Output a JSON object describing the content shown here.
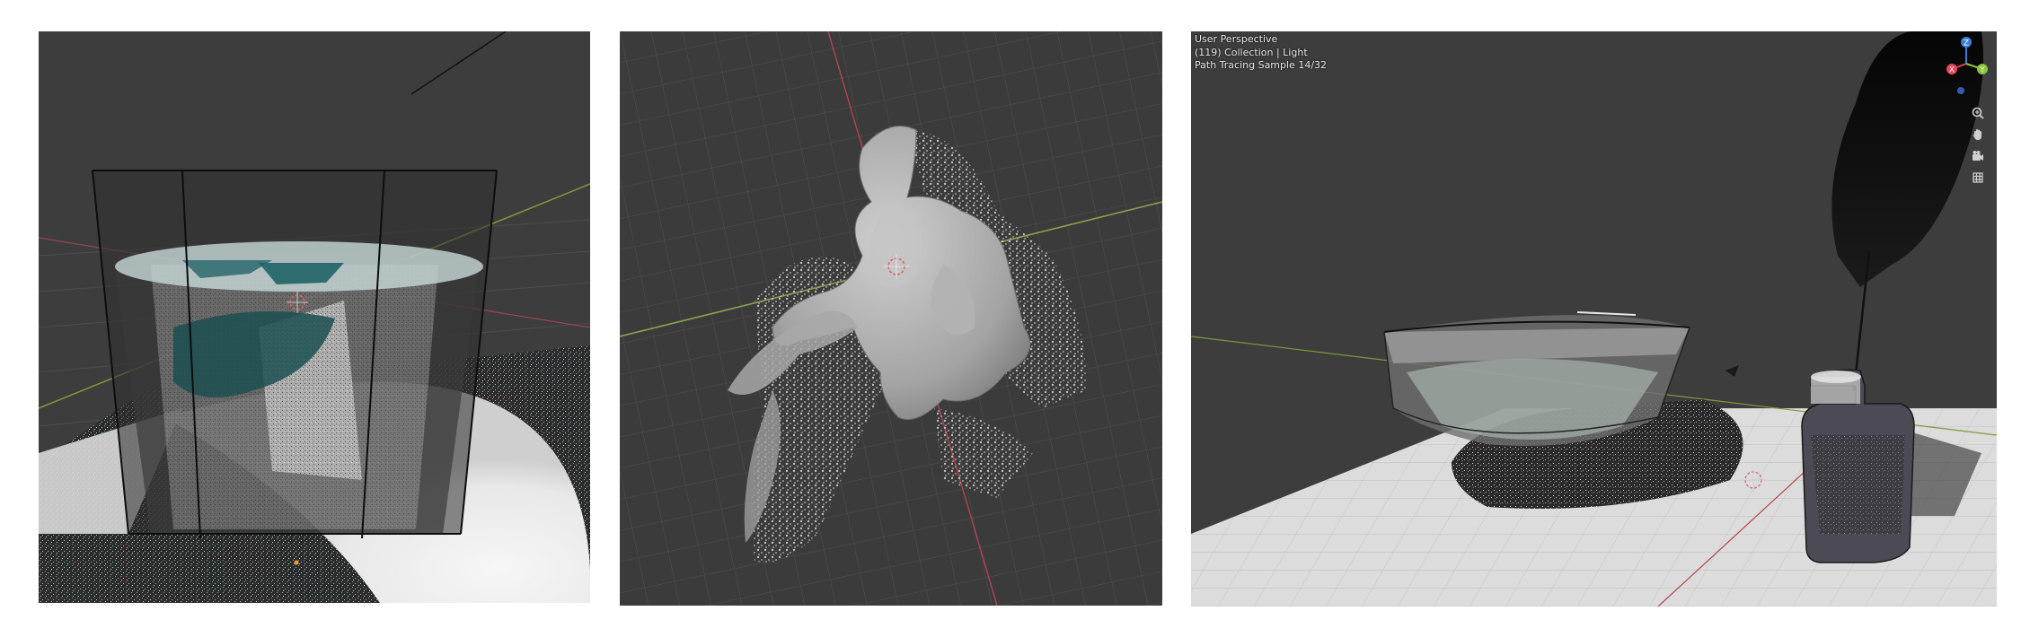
{
  "viewports": [
    {
      "name": "glass-cup-viewport"
    },
    {
      "name": "fluid-splash-viewport"
    },
    {
      "name": "inkwell-viewport",
      "overlay": {
        "view_name": "User Perspective",
        "collection": "(119) Collection | Light",
        "render_status": "Path Tracing Sample 14/32"
      },
      "gizmo": {
        "z_label": "Z",
        "y_label": "Y",
        "x_label": "X",
        "colors": {
          "x": "#e8455a",
          "y": "#8ac43b",
          "z": "#3f7cd9"
        }
      },
      "nav_icons": [
        "zoom-icon",
        "hand-pan-icon",
        "camera-icon",
        "grid-ortho-icon"
      ]
    }
  ],
  "colors": {
    "viewport_bg": "#3d3d3d",
    "grid_line": "#4a4a4a",
    "x_axis": "#b5434f",
    "y_axis": "#7e9a3a"
  }
}
